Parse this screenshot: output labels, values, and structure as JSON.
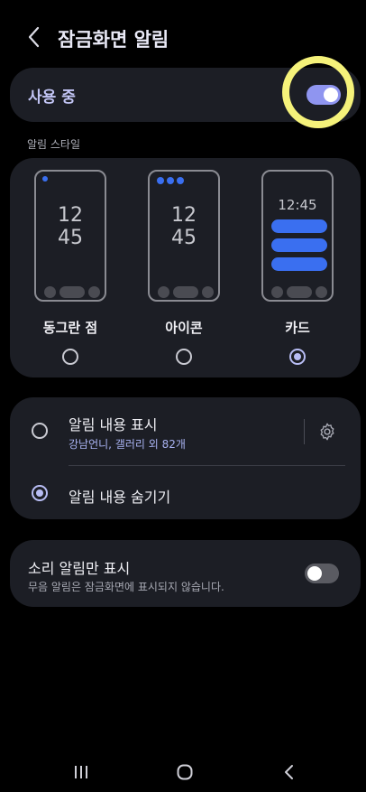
{
  "header": {
    "title": "잠금화면 알림",
    "back_icon": "chevron-left-icon"
  },
  "master": {
    "label": "사용 중",
    "on": true
  },
  "style_section": {
    "label": "알림 스타일",
    "options": [
      {
        "label": "동그란 점",
        "time_top": "12",
        "time_bottom": "45",
        "selected": false
      },
      {
        "label": "아이콘",
        "time_top": "12",
        "time_bottom": "45",
        "selected": false
      },
      {
        "label": "카드",
        "time": "12:45",
        "selected": true
      }
    ]
  },
  "content": {
    "show": {
      "label": "알림 내용 표시",
      "sub": "강남언니, 갤러리 외 82개",
      "selected": false
    },
    "hide": {
      "label": "알림 내용 숨기기",
      "selected": true
    }
  },
  "sound_only": {
    "label": "소리 알림만 표시",
    "sub": "무음 알림은 잠금화면에 표시되지 않습니다.",
    "on": false
  },
  "colors": {
    "accent": "#8f95f0",
    "highlight": "#f5f27a",
    "card_bg": "#1c1e25",
    "blue_bar": "#3a6ff0"
  }
}
